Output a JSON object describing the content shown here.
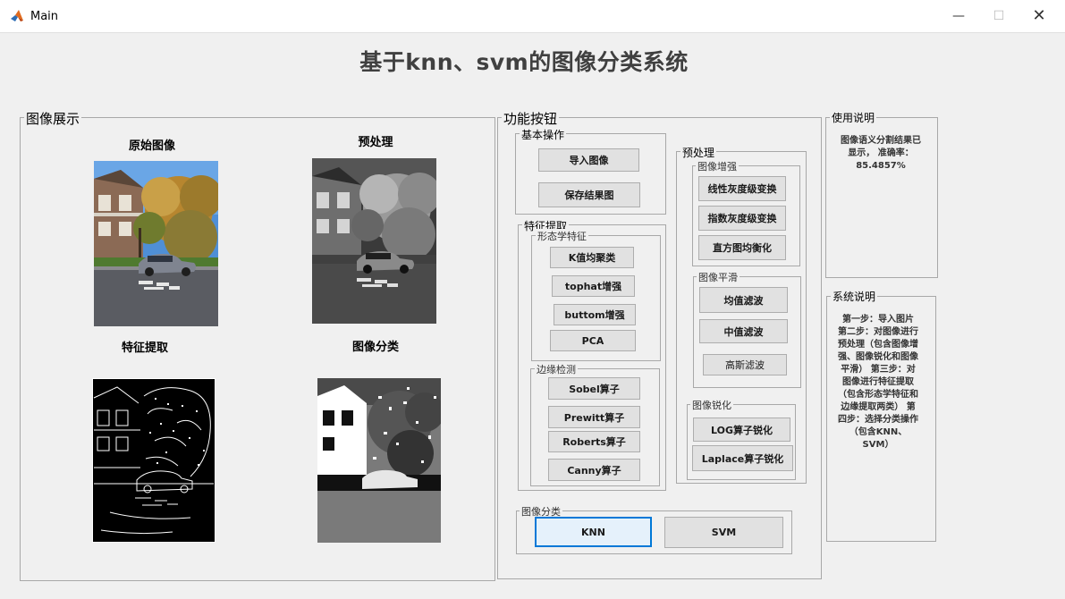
{
  "window": {
    "title": "Main"
  },
  "app_title": "基于knn、svm的图像分类系统",
  "display_panel": {
    "legend": "图像展示",
    "captions": {
      "original": "原始图像",
      "preprocess": "预处理",
      "feature": "特征提取",
      "classify": "图像分类"
    }
  },
  "function_panel": {
    "legend": "功能按钮",
    "basic": {
      "legend": "基本操作",
      "import": "导入图像",
      "save": "保存结果图"
    },
    "feature": {
      "legend": "特征提取",
      "morph": {
        "legend": "形态学特征",
        "kmeans": "K值均聚类",
        "tophat": "tophat增强",
        "buttom": "buttom增强",
        "pca": "PCA"
      },
      "edge": {
        "legend": "边缘检测",
        "sobel": "Sobel算子",
        "prewitt": "Prewitt算子",
        "roberts": "Roberts算子",
        "canny": "Canny算子"
      }
    },
    "preprocess": {
      "legend": "预处理",
      "enhance": {
        "legend": "图像增强",
        "linear": "线性灰度级变换",
        "exp": "指数灰度级变换",
        "hist": "直方图均衡化"
      },
      "smooth": {
        "legend": "图像平滑",
        "mean": "均值滤波",
        "median": "中值滤波",
        "gauss": "高斯滤波"
      },
      "sharpen": {
        "legend": "图像锐化",
        "log": "LOG算子锐化",
        "laplace": "Laplace算子锐化"
      }
    },
    "classify": {
      "legend": "图像分类",
      "knn": "KNN",
      "svm": "SVM"
    }
  },
  "usage": {
    "legend": "使用说明",
    "text": "图像语义分割结果已显示， 准确率：85.4857%"
  },
  "system": {
    "legend": "系统说明",
    "text": "第一步：导入图片 第二步：对图像进行预处理（包含图像增强、图像锐化和图像平滑） 第三步：对图像进行特征提取（包含形态学特征和边缘提取两类） 第四步：选择分类操作（包含KNN、SVM）"
  }
}
